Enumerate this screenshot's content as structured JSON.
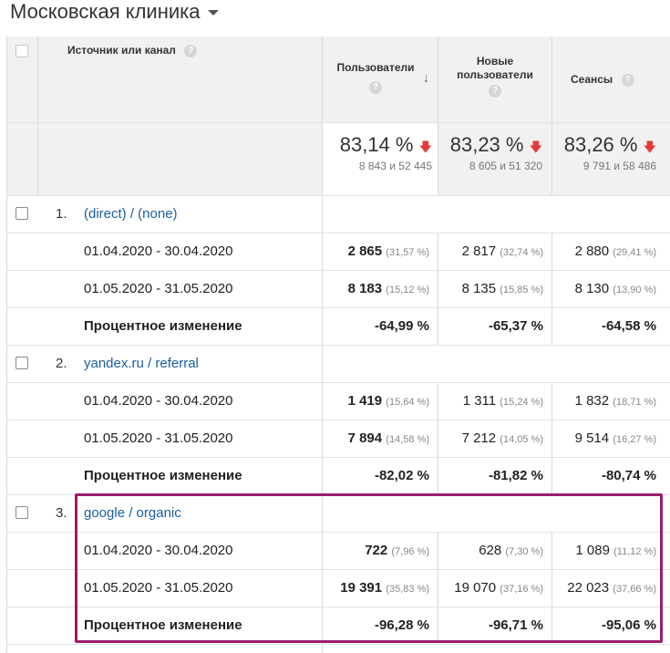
{
  "title": "Московская клиника",
  "header": {
    "source_label": "Источник или канал",
    "col_users": "Пользователи",
    "col_new_users_1": "Новые",
    "col_new_users_2": "пользователи",
    "col_sessions": "Сеансы",
    "help_glyph": "?",
    "sort_glyph": "↓"
  },
  "totals": {
    "users": {
      "value": "83,14 %",
      "sub": "8 843 и 52 445"
    },
    "new_users": {
      "value": "83,23 %",
      "sub": "8 605 и 51 320"
    },
    "sessions": {
      "value": "83,26 %",
      "sub": "9 791 и 58 486"
    },
    "down_glyph": "🡇"
  },
  "groups": [
    {
      "num": "1.",
      "source": "(direct) / (none)",
      "rows": [
        {
          "label": "01.04.2020 - 30.04.2020",
          "users": "2 865",
          "users_pct": "(31,57 %)",
          "new_users": "2 817",
          "new_users_pct": "(32,74 %)",
          "sessions": "2 880",
          "sessions_pct": "(29,41 %)"
        },
        {
          "label": "01.05.2020 - 31.05.2020",
          "users": "8 183",
          "users_pct": "(15,12 %)",
          "new_users": "8 135",
          "new_users_pct": "(15,85 %)",
          "sessions": "8 130",
          "sessions_pct": "(13,90 %)"
        }
      ],
      "change": {
        "label": "Процентное изменение",
        "users": "-64,99 %",
        "new_users": "-65,37 %",
        "sessions": "-64,58 %"
      }
    },
    {
      "num": "2.",
      "source": "yandex.ru / referral",
      "rows": [
        {
          "label": "01.04.2020 - 30.04.2020",
          "users": "1 419",
          "users_pct": "(15,64 %)",
          "new_users": "1 311",
          "new_users_pct": "(15,24 %)",
          "sessions": "1 832",
          "sessions_pct": "(18,71 %)"
        },
        {
          "label": "01.05.2020 - 31.05.2020",
          "users": "7 894",
          "users_pct": "(14,58 %)",
          "new_users": "7 212",
          "new_users_pct": "(14,05 %)",
          "sessions": "9 514",
          "sessions_pct": "(16,27 %)"
        }
      ],
      "change": {
        "label": "Процентное изменение",
        "users": "-82,02 %",
        "new_users": "-81,82 %",
        "sessions": "-80,74 %"
      }
    },
    {
      "num": "3.",
      "source": "google / organic",
      "rows": [
        {
          "label": "01.04.2020 - 30.04.2020",
          "users": "722",
          "users_pct": "(7,96 %)",
          "new_users": "628",
          "new_users_pct": "(7,30 %)",
          "sessions": "1 089",
          "sessions_pct": "(11,12 %)"
        },
        {
          "label": "01.05.2020 - 31.05.2020",
          "users": "19 391",
          "users_pct": "(35,83 %)",
          "new_users": "19 070",
          "new_users_pct": "(37,16 %)",
          "sessions": "22 023",
          "sessions_pct": "(37,66 %)"
        }
      ],
      "change": {
        "label": "Процентное изменение",
        "users": "-96,28 %",
        "new_users": "-96,71 %",
        "sessions": "-95,06 %"
      }
    }
  ],
  "colors": {
    "link": "#1a5fa0",
    "down_arrow": "#e53935",
    "highlight": "#9c1c6b",
    "header_bg": "#f1f1f1"
  }
}
